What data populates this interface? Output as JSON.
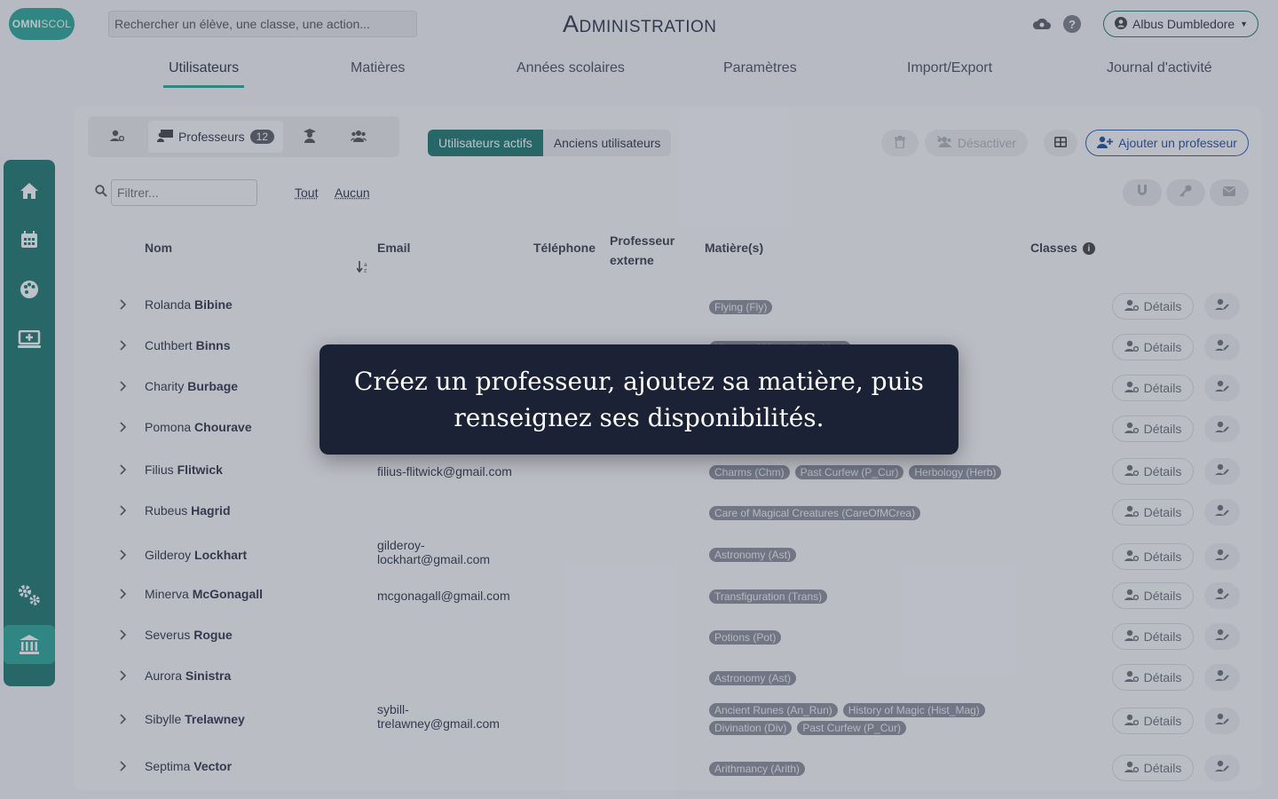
{
  "app": {
    "logo_text_bold": "OMNI",
    "logo_text_light": "SCOL",
    "search_placeholder": "Rechercher un élève, une classe, une action...",
    "title": "Administration",
    "user_name": "Albus Dumbledore",
    "help_symbol": "?"
  },
  "nav": {
    "tabs": [
      {
        "label": "Utilisateurs",
        "active": true
      },
      {
        "label": "Matières"
      },
      {
        "label": "Années scolaires"
      },
      {
        "label": "Paramètres"
      },
      {
        "label": "Import/Export"
      },
      {
        "label": "Journal d'activité"
      }
    ]
  },
  "sidebar": {
    "items": [
      "home-icon",
      "calendar-icon",
      "palette-icon",
      "display-plus-icon",
      "cogs-icon",
      "institution-icon"
    ]
  },
  "toolbar": {
    "role_tab_label": "Professeurs",
    "role_tab_count": "12",
    "active_users": "Utilisateurs actifs",
    "former_users": "Anciens utilisateurs",
    "deactivate": "Désactiver",
    "add_teacher": "Ajouter un professeur"
  },
  "filter": {
    "placeholder": "Filtrer...",
    "select_all": "Tout",
    "select_none": "Aucun"
  },
  "table": {
    "headers": {
      "name": "Nom",
      "email": "Email",
      "phone": "Téléphone",
      "external_line1": "Professeur",
      "external_line2": "externe",
      "subjects": "Matière(s)",
      "classes": "Classes",
      "classes_info": "i"
    },
    "details_label": "Détails",
    "rows": [
      {
        "first": "Rolanda",
        "last": "Bibine",
        "email": "",
        "subjects": [
          "Flying (Fly)"
        ]
      },
      {
        "first": "Cuthbert",
        "last": "Binns",
        "email": "",
        "subjects": [
          "History of Magic (Hist_Mag)"
        ]
      },
      {
        "first": "Charity",
        "last": "Burbage",
        "email": "",
        "subjects": []
      },
      {
        "first": "Pomona",
        "last": "Chourave",
        "email": "",
        "subjects": []
      },
      {
        "first": "Filius",
        "last": "Flitwick",
        "email": "filius-flitwick@gmail.com",
        "subjects": [
          "Charms (Chm)",
          "Past Curfew (P_Cur)",
          "Herbology (Herb)"
        ]
      },
      {
        "first": "Rubeus",
        "last": "Hagrid",
        "email": "",
        "subjects": [
          "Care of Magical Creatures (CareOfMCrea)"
        ]
      },
      {
        "first": "Gilderoy",
        "last": "Lockhart",
        "email": "gilderoy-\nlockhart@gmail.com",
        "subjects": [
          "Astronomy (Ast)"
        ]
      },
      {
        "first": "Minerva",
        "last": "McGonagall",
        "email": "mcgonagall@gmail.com",
        "subjects": [
          "Transfiguration (Trans)"
        ]
      },
      {
        "first": "Severus",
        "last": "Rogue",
        "email": "",
        "subjects": [
          "Potions (Pot)"
        ]
      },
      {
        "first": "Aurora",
        "last": "Sinistra",
        "email": "",
        "subjects": [
          "Astronomy (Ast)"
        ]
      },
      {
        "first": "Sibylle",
        "last": "Trelawney",
        "email": "sybill-\ntrelawney@gmail.com",
        "subjects": [
          "Ancient Runes (An_Run)",
          "History of Magic (Hist_Mag)",
          "Divination (Div)",
          "Past Curfew (P_Cur)"
        ]
      },
      {
        "first": "Septima",
        "last": "Vector",
        "email": "",
        "subjects": [
          "Arithmancy (Arith)"
        ]
      }
    ]
  },
  "overlay": {
    "message_line1": "Créez un professeur, ajoutez sa matière, puis",
    "message_line2": "renseignez ses disponibilités."
  }
}
